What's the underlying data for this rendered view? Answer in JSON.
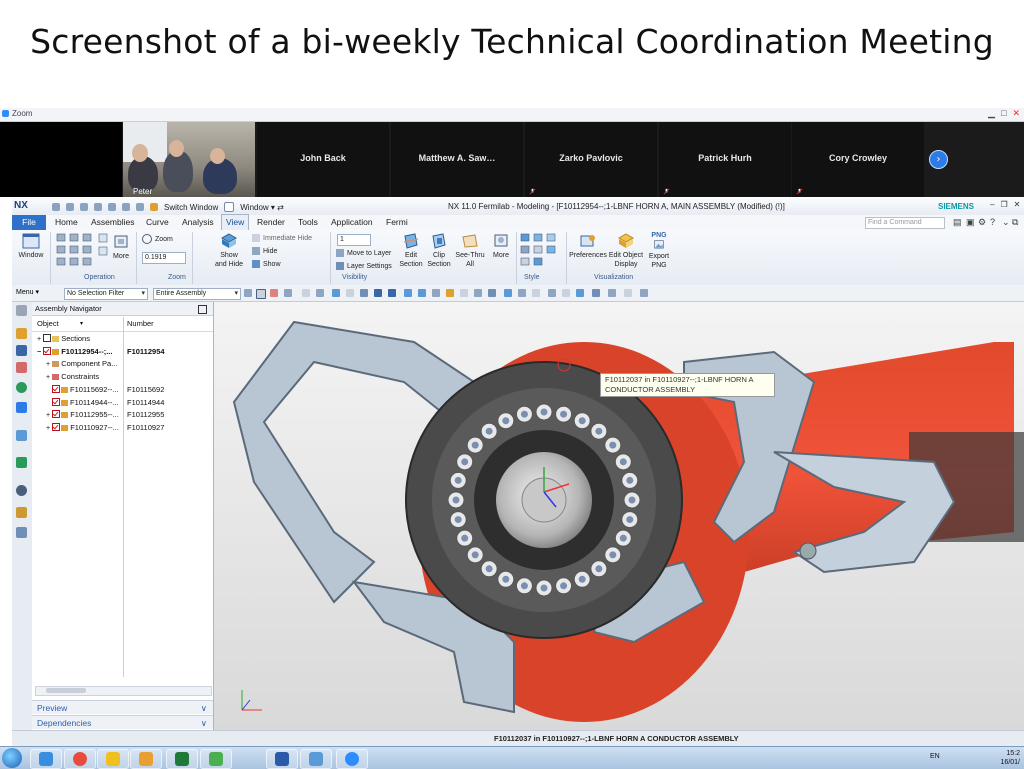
{
  "slide": {
    "title": "Screenshot of a bi-weekly Technical Coordination Meeting"
  },
  "zoom": {
    "window_title": "Zoom",
    "self_video_label": "Peter",
    "participants": [
      "John Back",
      "Matthew A. Saw…",
      "Zarko Pavlovic",
      "Patrick Hurh",
      "Cory Crowley"
    ],
    "next_icon": "chevron-right-circle-icon"
  },
  "nx": {
    "logo": "NX",
    "quick_access": {
      "switch_window": "Switch Window",
      "window_menu": "Window ▾ ⇄"
    },
    "title": "NX 11.0 Fermilab - Modeling - [F10112954--;1-LBNF HORN A, MAIN ASSEMBLY (Modified)   (!)]",
    "brand": "SIEMENS",
    "menu_tabs": [
      "File",
      "Home",
      "Assemblies",
      "Curve",
      "Analysis",
      "View",
      "Render",
      "Tools",
      "Application",
      "Fermi"
    ],
    "active_tab": "View",
    "find_command_placeholder": "Find a Command",
    "ribbon": {
      "window_label": "Window",
      "zoom_label": "Zoom",
      "zoom_value": "0.1919",
      "more_label": "More",
      "show_and_hide": "Show and Hide",
      "immediate_hide": "Immediate Hide",
      "hide": "Hide",
      "show": "Show",
      "layer_value": "1",
      "move_to_layer": "Move to Layer",
      "layer_settings": "Layer Settings",
      "edit_section": "Edit Section",
      "clip_section": "Clip Section",
      "see_thru_all": "See-Thru All",
      "more_label2": "More",
      "preferences": "Preferences",
      "edit_object_display": "Edit Object Display",
      "export_png_badge": "PNG",
      "export_png": "Export PNG",
      "groups": [
        "Operation",
        "Zoom",
        "Visibility",
        "Style",
        "Visualization"
      ]
    },
    "toolbar2": {
      "menu": "Menu ▾",
      "selection_filter": "No Selection Filter",
      "scope": "Entire Assembly"
    },
    "navigator": {
      "title": "Assembly Navigator",
      "col_object": "Object",
      "col_number": "Number",
      "rows": [
        {
          "name": "Sections",
          "number": ""
        },
        {
          "name": "F10112954--;...",
          "number": "F10112954"
        },
        {
          "name": "Component Pa...",
          "number": ""
        },
        {
          "name": "Constraints",
          "number": ""
        },
        {
          "name": "F10115692--...",
          "number": "F10115692"
        },
        {
          "name": "F10114944--...",
          "number": "F10114944"
        },
        {
          "name": "F10112955--...",
          "number": "F10112955"
        },
        {
          "name": "F10110927--...",
          "number": "F10110927"
        }
      ],
      "preview": "Preview",
      "dependencies": "Dependencies"
    },
    "tooltip": "F10112037 in F10110927--;1-LBNF HORN A CONDUCTOR ASSEMBLY",
    "status": "F10112037 in F10110927--;1-LBNF HORN A CONDUCTOR ASSEMBLY"
  },
  "taskbar": {
    "apps": [
      "ie-icon",
      "chrome-icon",
      "outlook-icon",
      "norton-icon",
      "excel-icon",
      "network-icon",
      "word-icon",
      "explorer-icon",
      "zoom-icon"
    ],
    "lang": "EN",
    "time": "15:2",
    "date": "16/01/"
  }
}
